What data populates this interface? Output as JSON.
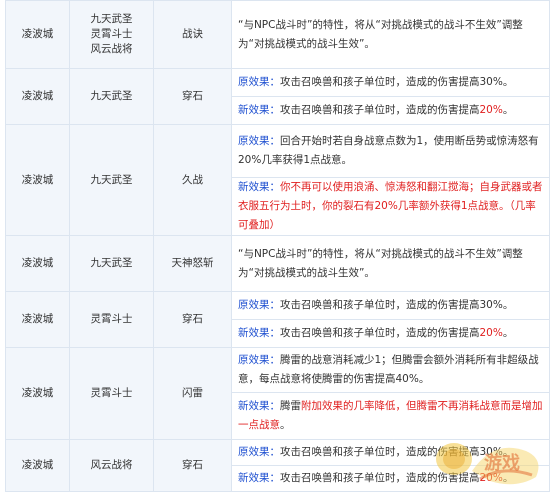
{
  "rows": [
    {
      "city": "凌波城",
      "school_lines": [
        "九天武圣",
        "灵霄斗士",
        "风云战将"
      ],
      "skill": "战诀",
      "cells": [
        [
          {
            "t": "“与NPC战斗时”的特性，将从“对挑战模式的战斗不生效”调整为“对挑战模式的战斗生效”。"
          }
        ]
      ]
    },
    {
      "city": "凌波城",
      "school_lines": [
        "九天武圣"
      ],
      "skill": "穿石",
      "cells": [
        [
          {
            "t": "原效果：",
            "c": "lbl-blue"
          },
          {
            "t": "攻击召唤兽和孩子单位时，造成的伤害提高30%。"
          }
        ],
        [
          {
            "t": "新效果：",
            "c": "lbl-blue"
          },
          {
            "t": "攻击召唤兽和孩子单位时，造成的伤害提高"
          },
          {
            "t": "20%",
            "c": "red"
          },
          {
            "t": "。"
          }
        ]
      ]
    },
    {
      "city": "凌波城",
      "school_lines": [
        "九天武圣"
      ],
      "skill": "久战",
      "cells": [
        [
          {
            "t": "原效果：",
            "c": "lbl-blue"
          },
          {
            "t": "回合开始时若自身战意点数为1，使用断岳势或惊涛怒有20%几率获得1点战意。"
          }
        ],
        [
          {
            "t": "新效果：",
            "c": "lbl-blue"
          },
          {
            "t": "你不再可以使用浪涌、惊涛怒和翻江搅海；自身武器或者衣服五行为土时，你的裂石有20%几率额外获得1点战意。（几率可叠加）",
            "c": "red"
          }
        ]
      ]
    },
    {
      "city": "凌波城",
      "school_lines": [
        "九天武圣"
      ],
      "skill": "天神怒斩",
      "cells": [
        [
          {
            "t": "“与NPC战斗时”的特性，将从“对挑战模式的战斗不生效”调整为“对挑战模式的战斗生效”。"
          }
        ]
      ]
    },
    {
      "city": "凌波城",
      "school_lines": [
        "灵霄斗士"
      ],
      "skill": "穿石",
      "cells": [
        [
          {
            "t": "原效果：",
            "c": "lbl-blue"
          },
          {
            "t": "攻击召唤兽和孩子单位时，造成的伤害提高30%。"
          }
        ],
        [
          {
            "t": "新效果：",
            "c": "lbl-blue"
          },
          {
            "t": "攻击召唤兽和孩子单位时，造成的伤害提高"
          },
          {
            "t": "20%",
            "c": "red"
          },
          {
            "t": "。"
          }
        ]
      ]
    },
    {
      "city": "凌波城",
      "school_lines": [
        "灵霄斗士"
      ],
      "skill": "闪雷",
      "cells": [
        [
          {
            "t": "原效果：",
            "c": "lbl-blue"
          },
          {
            "t": "腾雷的战意消耗减少1；但腾雷会额外消耗所有非超级战意，每点战意将使腾雷的伤害提高40%。"
          }
        ],
        [
          {
            "t": "新效果：",
            "c": "lbl-blue"
          },
          {
            "t": "腾雷"
          },
          {
            "t": "附加效果的几率降低，但腾雷不再消耗战意而是增加一点战意",
            "c": "red"
          },
          {
            "t": "。"
          }
        ]
      ]
    },
    {
      "city": "凌波城",
      "school_lines": [
        "风云战将"
      ],
      "skill": "穿石",
      "cells": [
        [
          {
            "t": "原效果：",
            "c": "lbl-blue"
          },
          {
            "t": "攻击召唤兽和孩子单位时，造成的伤害提高30%。"
          }
        ],
        [
          {
            "t": "新效果：",
            "c": "lbl-blue"
          },
          {
            "t": "攻击召唤兽和孩子单位时，造成的伤害提高"
          },
          {
            "t": "20%",
            "c": "red"
          },
          {
            "t": "。"
          }
        ]
      ]
    }
  ],
  "watermark": {
    "text": "游戏"
  },
  "colors": {
    "border": "#dce5f0",
    "label_blue": "#1f50d0",
    "highlight_red": "#e02020",
    "left_bg": "#f2f6fb"
  }
}
